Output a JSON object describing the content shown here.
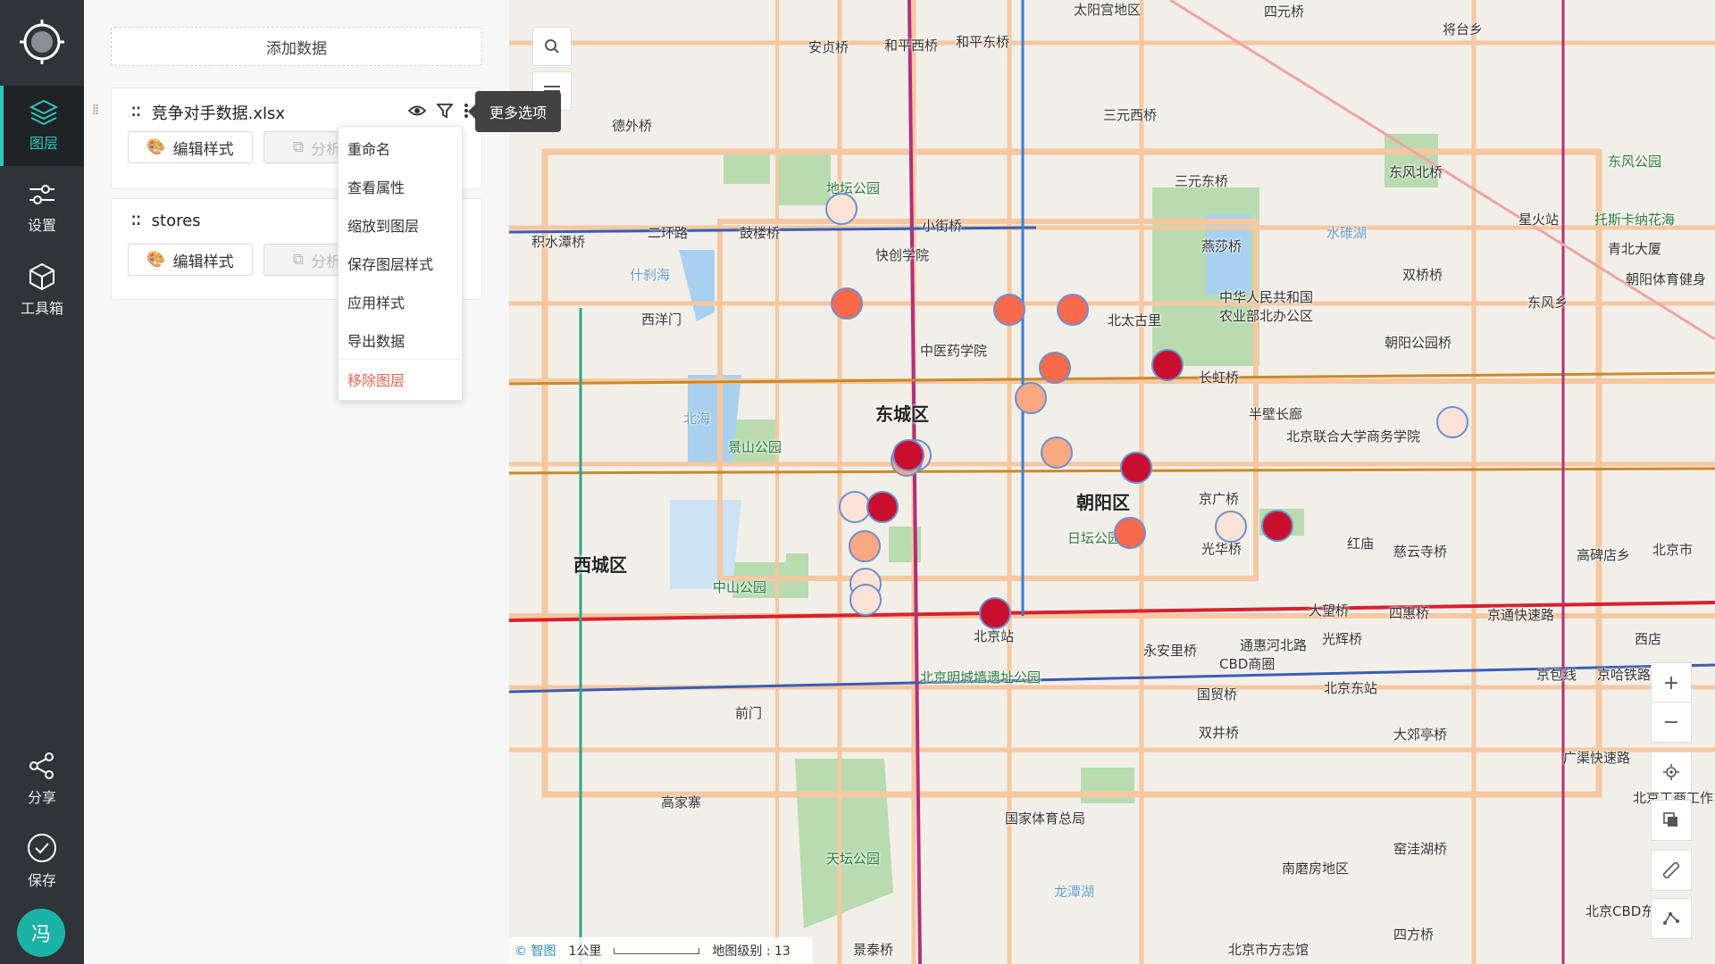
{
  "sidebar": {
    "items": [
      {
        "label": "图层",
        "icon": "layers-icon"
      },
      {
        "label": "设置",
        "icon": "sliders-icon"
      },
      {
        "label": "工具箱",
        "icon": "cube-icon"
      }
    ],
    "bottom": [
      {
        "label": "分享",
        "icon": "share-icon"
      },
      {
        "label": "保存",
        "icon": "check-circle-icon"
      }
    ],
    "avatar_text": "冯"
  },
  "panel": {
    "add_data_label": "添加数据",
    "layers": [
      {
        "name": "竞争对手数据.xlsx",
        "edit_style": "编辑样式",
        "analyze": "分析"
      },
      {
        "name": "stores",
        "edit_style": "编辑样式",
        "analyze": "分析"
      }
    ]
  },
  "context_menu": {
    "items": [
      "重命名",
      "查看属性",
      "缩放到图层",
      "保存图层样式",
      "应用样式",
      "导出数据"
    ],
    "danger_item": "移除图层"
  },
  "tooltip": "更多选项",
  "map": {
    "labels": [
      {
        "text": "太阳宫地区",
        "cls": ""
      },
      {
        "text": "四元桥",
        "cls": ""
      },
      {
        "text": "将台乡",
        "cls": ""
      },
      {
        "text": "安贞桥",
        "cls": ""
      },
      {
        "text": "和平西桥",
        "cls": ""
      },
      {
        "text": "和平东桥",
        "cls": ""
      },
      {
        "text": "德外桥",
        "cls": ""
      },
      {
        "text": "三元西桥",
        "cls": ""
      },
      {
        "text": "三元东桥",
        "cls": ""
      },
      {
        "text": "东风北桥",
        "cls": ""
      },
      {
        "text": "东风公园",
        "cls": "green"
      },
      {
        "text": "地坛公园",
        "cls": "green"
      },
      {
        "text": "积水潭桥",
        "cls": ""
      },
      {
        "text": "二环路",
        "cls": ""
      },
      {
        "text": "鼓楼桥",
        "cls": ""
      },
      {
        "text": "小街桥",
        "cls": ""
      },
      {
        "text": "快创学院",
        "cls": ""
      },
      {
        "text": "燕莎桥",
        "cls": ""
      },
      {
        "text": "水碓湖",
        "cls": "blue"
      },
      {
        "text": "星火站",
        "cls": ""
      },
      {
        "text": "托斯卡纳花海",
        "cls": "green"
      },
      {
        "text": "青北大厦",
        "cls": ""
      },
      {
        "text": "双桥桥",
        "cls": ""
      },
      {
        "text": "什刹海",
        "cls": "blue"
      },
      {
        "text": "西洋门",
        "cls": ""
      },
      {
        "text": "中华人民共和国农业部北办公区",
        "cls": ""
      },
      {
        "text": "北太古里",
        "cls": ""
      },
      {
        "text": "朝阳体育健身",
        "cls": ""
      },
      {
        "text": "东风乡",
        "cls": ""
      },
      {
        "text": "朝阳公园桥",
        "cls": ""
      },
      {
        "text": "中医药学院",
        "cls": ""
      },
      {
        "text": "长虹桥",
        "cls": ""
      },
      {
        "text": "东城区",
        "cls": "district"
      },
      {
        "text": "北海",
        "cls": "blue"
      },
      {
        "text": "景山公园",
        "cls": "green"
      },
      {
        "text": "半壁长廊",
        "cls": ""
      },
      {
        "text": "北京联合大学商务学院",
        "cls": ""
      },
      {
        "text": "朝阳区",
        "cls": "district"
      },
      {
        "text": "京广桥",
        "cls": ""
      },
      {
        "text": "西城区",
        "cls": "district"
      },
      {
        "text": "日坛公园",
        "cls": "green"
      },
      {
        "text": "光华桥",
        "cls": ""
      },
      {
        "text": "红庙",
        "cls": ""
      },
      {
        "text": "慈云寺桥",
        "cls": ""
      },
      {
        "text": "高碑店乡",
        "cls": ""
      },
      {
        "text": "北京市",
        "cls": ""
      },
      {
        "text": "中山公园",
        "cls": "green"
      },
      {
        "text": "北京站",
        "cls": ""
      },
      {
        "text": "大望桥",
        "cls": ""
      },
      {
        "text": "四惠桥",
        "cls": ""
      },
      {
        "text": "京通快速路",
        "cls": ""
      },
      {
        "text": "西店",
        "cls": ""
      },
      {
        "text": "永安里桥",
        "cls": ""
      },
      {
        "text": "通惠河北路",
        "cls": ""
      },
      {
        "text": "光辉桥",
        "cls": ""
      },
      {
        "text": "CBD商圈",
        "cls": ""
      },
      {
        "text": "北京明城墙遗址公园",
        "cls": "green"
      },
      {
        "text": "北京东站",
        "cls": ""
      },
      {
        "text": "京包线",
        "cls": ""
      },
      {
        "text": "京哈铁路",
        "cls": ""
      },
      {
        "text": "前门",
        "cls": ""
      },
      {
        "text": "国贸桥",
        "cls": ""
      },
      {
        "text": "双井桥",
        "cls": ""
      },
      {
        "text": "大郊亭桥",
        "cls": ""
      },
      {
        "text": "广渠快速路",
        "cls": ""
      },
      {
        "text": "北京工商工作",
        "cls": ""
      },
      {
        "text": "高家寨",
        "cls": ""
      },
      {
        "text": "国家体育总局",
        "cls": ""
      },
      {
        "text": "天坛公园",
        "cls": "green"
      },
      {
        "text": "窑洼湖桥",
        "cls": ""
      },
      {
        "text": "南磨房地区",
        "cls": ""
      },
      {
        "text": "龙潭湖",
        "cls": "blue"
      },
      {
        "text": "北京CBD东",
        "cls": ""
      },
      {
        "text": "景泰桥",
        "cls": ""
      },
      {
        "text": "北京市方志馆",
        "cls": ""
      },
      {
        "text": "四方桥",
        "cls": ""
      }
    ],
    "markers": [
      {
        "c": "#fde3d7"
      },
      {
        "c": "#f9694c"
      },
      {
        "c": "#f9694c"
      },
      {
        "c": "#f9694c"
      },
      {
        "c": "#f9694c"
      },
      {
        "c": "#c8102e"
      },
      {
        "c": "#f9a882"
      },
      {
        "c": "#fde3d7"
      },
      {
        "c": "#f9a882"
      },
      {
        "c": "#f9a882"
      },
      {
        "c": "#c8102e"
      },
      {
        "c": "#c8102e"
      },
      {
        "c": "#fde3d7"
      },
      {
        "c": "#c8102e"
      },
      {
        "c": "#fde3d7"
      },
      {
        "c": "#f9a882"
      },
      {
        "c": "#fde3d7"
      },
      {
        "c": "#f9694c"
      },
      {
        "c": "#c8102e"
      },
      {
        "c": "#fde3d7"
      },
      {
        "c": "#c8102e"
      },
      {
        "c": "#fde3d7"
      }
    ],
    "scale_label": "1公里",
    "zoom_label": "地图级别 : 13",
    "attribution": "© 智图"
  }
}
